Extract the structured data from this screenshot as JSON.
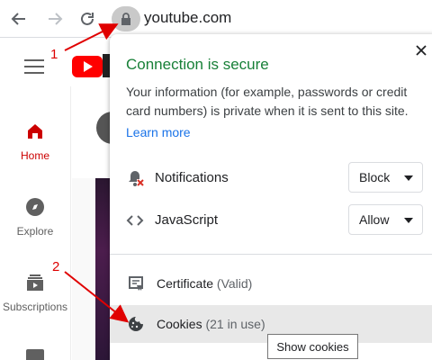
{
  "browser": {
    "url": "youtube.com",
    "back_icon": "arrow-left-icon",
    "forward_icon": "arrow-right-icon",
    "reload_icon": "reload-icon",
    "lock_icon": "lock-icon"
  },
  "youtube": {
    "sidebar": [
      {
        "label": "Home",
        "icon": "home-icon",
        "active": true
      },
      {
        "label": "Explore",
        "icon": "compass-icon",
        "active": false
      },
      {
        "label": "Subscriptions",
        "icon": "subscriptions-icon",
        "active": false
      }
    ]
  },
  "popup": {
    "title": "Connection is secure",
    "description": "Your information (for example, passwords or credit card numbers) is private when it is sent to this site.",
    "learn_more": "Learn more",
    "permissions": [
      {
        "label": "Notifications",
        "value": "Block",
        "icon": "bell-blocked-icon"
      },
      {
        "label": "JavaScript",
        "value": "Allow",
        "icon": "code-icon"
      }
    ],
    "certificate": {
      "label": "Certificate",
      "status": "(Valid)",
      "icon": "certificate-icon"
    },
    "cookies": {
      "label": "Cookies",
      "count": "(21 in use)",
      "icon": "cookie-icon"
    }
  },
  "tooltip": "Show cookies",
  "annotations": {
    "step1": "1",
    "step2": "2",
    "color": "#e00000"
  },
  "colors": {
    "secure_green": "#188038",
    "link_blue": "#1a73e8",
    "youtube_red": "#ff0000"
  }
}
